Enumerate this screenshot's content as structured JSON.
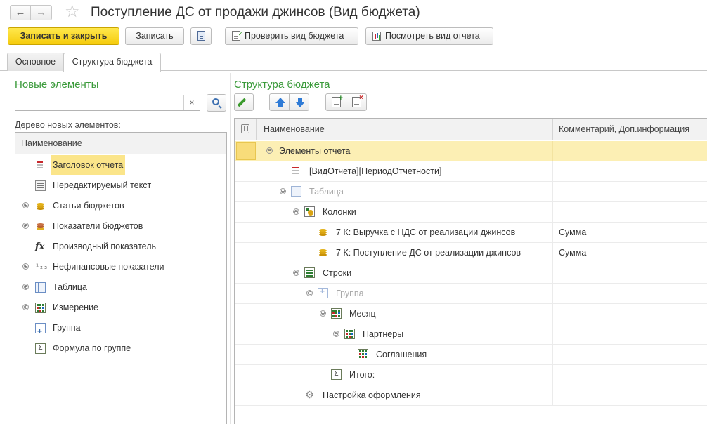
{
  "window": {
    "title": "Поступление ДС от продажи джинсов (Вид бюджета)",
    "nav_back": "←",
    "nav_forward": "→",
    "star": "☆"
  },
  "toolbar": {
    "save_close_label": "Записать и закрыть",
    "save_label": "Записать",
    "check_label": "Проверить вид бюджета",
    "report_label": "Посмотреть вид отчета"
  },
  "tabs": [
    {
      "label": "Основное"
    },
    {
      "label": "Структура бюджета"
    }
  ],
  "left_pane": {
    "title": "Новые элементы",
    "search_value": "",
    "search_clear": "×",
    "tree_caption": "Дерево новых элементов:",
    "column_header": "Наименование",
    "items": [
      {
        "label": "Заголовок отчета",
        "icon": "report-header-icon",
        "expandable": false,
        "selected": true
      },
      {
        "label": "Нередактируемый текст",
        "icon": "text-icon",
        "expandable": false
      },
      {
        "label": "Статьи бюджетов",
        "icon": "coins-icon",
        "expandable": true
      },
      {
        "label": "Показатели бюджетов",
        "icon": "indicators-icon",
        "expandable": true
      },
      {
        "label": "Производный показатель",
        "icon": "fx-icon",
        "expandable": false
      },
      {
        "label": "Нефинансовые показатели",
        "icon": "nonfinancial-icon",
        "expandable": true
      },
      {
        "label": "Таблица",
        "icon": "table-icon",
        "expandable": true
      },
      {
        "label": "Измерение",
        "icon": "dimension-icon",
        "expandable": true
      },
      {
        "label": "Группа",
        "icon": "group-icon",
        "expandable": false
      },
      {
        "label": "Формула по группе",
        "icon": "sigma-icon",
        "expandable": false
      }
    ],
    "expand_glyph": "⊕",
    "fx_glyph": "fx",
    "nonfin_glyph": "¹₂₃",
    "sigma_glyph": "Σ"
  },
  "right_pane": {
    "title": "Структура бюджета",
    "columns": {
      "name": "Наименование",
      "comment": "Комментарий, Доп.информация"
    },
    "collapse_glyph": "⊖",
    "gear_glyph": "⚙",
    "sigma_glyph": "Σ",
    "rows": [
      {
        "label": "Элементы отчета",
        "comment": "",
        "icon": "none",
        "expander": true,
        "gray": false,
        "selected": true
      },
      {
        "label": "[ВидОтчета][ПериодОтчетности]",
        "comment": "",
        "icon": "report-header-icon",
        "expander": false,
        "gray": false
      },
      {
        "label": "Таблица",
        "comment": "",
        "icon": "table-icon",
        "expander": true,
        "gray": true
      },
      {
        "label": "Колонки",
        "comment": "",
        "icon": "columns-icon",
        "expander": true,
        "gray": false
      },
      {
        "label": "7 К: Выручка с НДС от реализации джинсов",
        "comment": "Сумма",
        "icon": "coins-icon",
        "expander": false,
        "gray": false
      },
      {
        "label": "7 К: Поступление ДС от реализации джинсов",
        "comment": "Сумма",
        "icon": "coins-icon",
        "expander": false,
        "gray": false
      },
      {
        "label": "Строки",
        "comment": "",
        "icon": "rows-icon",
        "expander": true,
        "gray": false
      },
      {
        "label": "Группа",
        "comment": "",
        "icon": "group-icon",
        "expander": true,
        "gray": true
      },
      {
        "label": "Месяц",
        "comment": "",
        "icon": "dimension-icon",
        "expander": true,
        "gray": false
      },
      {
        "label": "Партнеры",
        "comment": "",
        "icon": "dimension-icon",
        "expander": true,
        "gray": false
      },
      {
        "label": "Соглашения",
        "comment": "",
        "icon": "dimension-icon",
        "expander": false,
        "gray": false
      },
      {
        "label": "Итого:",
        "comment": "",
        "icon": "sigma-icon",
        "expander": false,
        "gray": false
      },
      {
        "label": "Настройка оформления",
        "comment": "",
        "icon": "gear-icon",
        "expander": false,
        "gray": false
      }
    ]
  },
  "colors": {
    "accent_yellow": "#f5cb0c",
    "section_green": "#3a9a3a",
    "selection": "#fcefb4"
  }
}
